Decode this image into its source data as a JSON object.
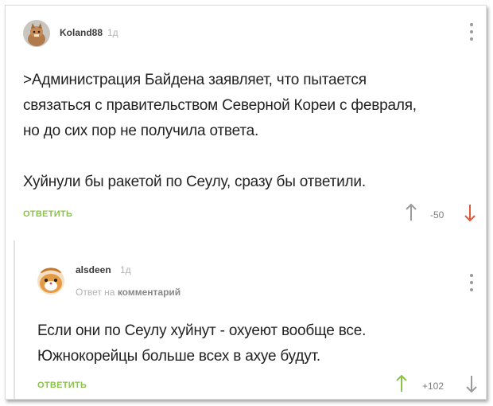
{
  "comments": [
    {
      "username": "Koland88",
      "time": "1д",
      "text_lines": [
        ">Администрация Байдена заявляет, что пытается",
        "связаться с правительством Северной Кореи с февраля,",
        "но до сих пор не получила ответа.",
        "",
        "Хуйнули бы ракетой по Сеулу, сразу бы ответили."
      ],
      "reply_label": "ОТВЕТИТЬ",
      "score": "-50",
      "avatar_icon": "cat-avatar-icon",
      "colors": {
        "up": "#9a9a9a",
        "down": "#e05a3a"
      }
    },
    {
      "username": "alsdeen",
      "time": "1д",
      "reply_to_prefix": "Ответ на",
      "reply_to_target": "комментарий",
      "text_lines": [
        "Если они по Сеулу хуйнут - охуеют вообще все.",
        "Южнокорейцы больше всех в ахуе будут."
      ],
      "reply_label": "ОТВЕТИТЬ",
      "score": "+102",
      "avatar_icon": "hamster-avatar-icon",
      "colors": {
        "up": "#8bc34a",
        "down": "#9a9a9a"
      }
    }
  ],
  "accent": "#8bc34a"
}
